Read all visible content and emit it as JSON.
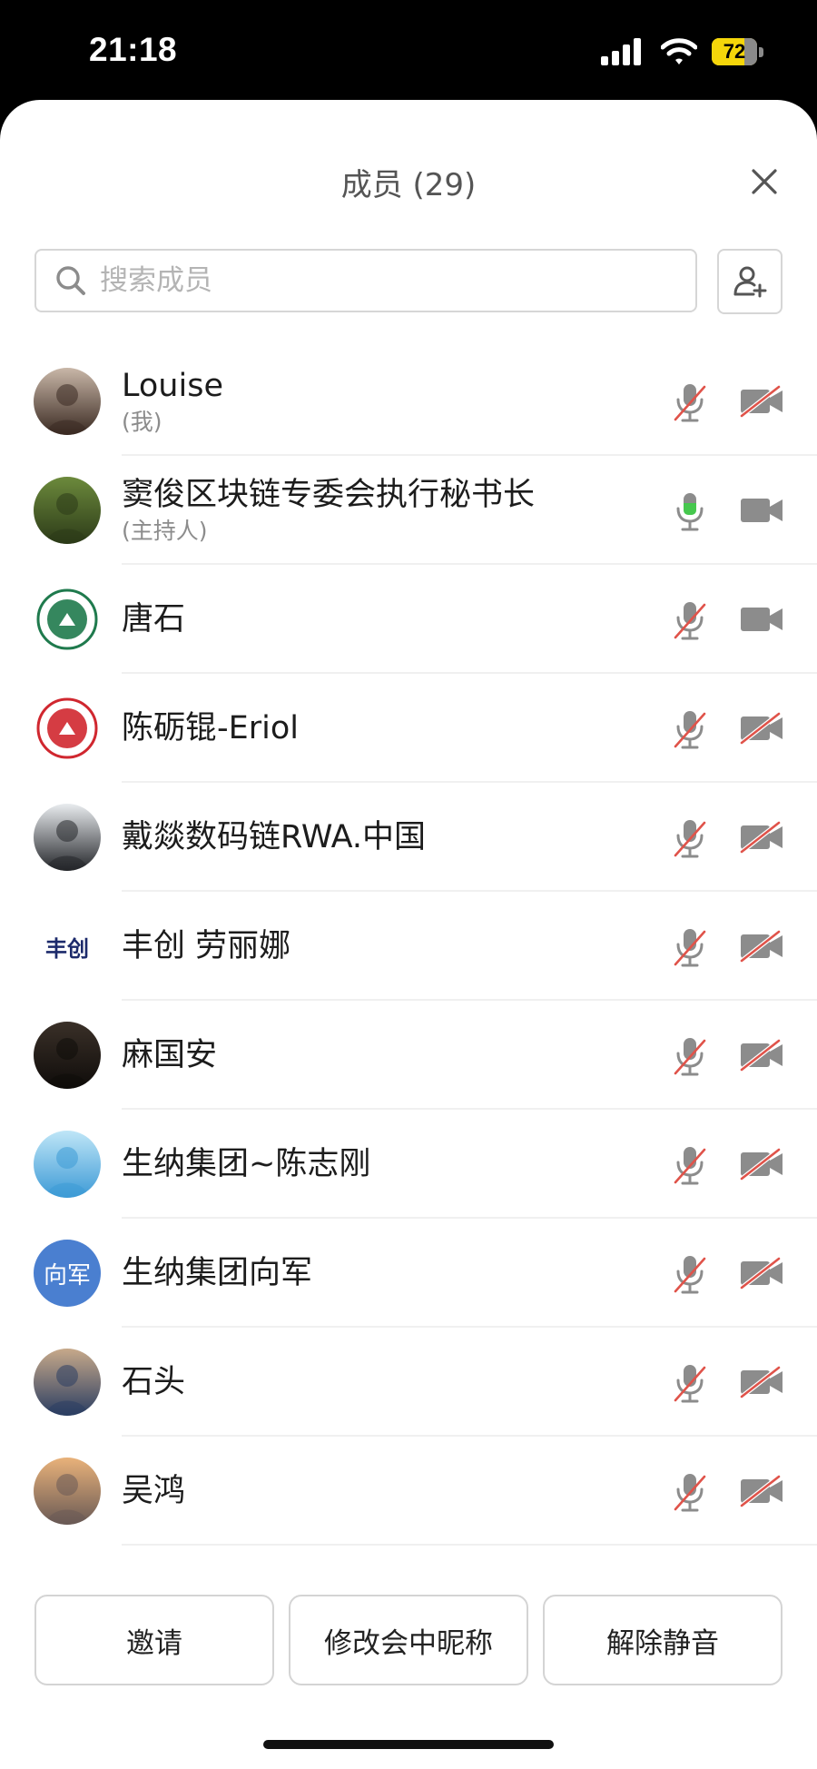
{
  "status_bar": {
    "time": "21:18",
    "battery": "72",
    "battery_level": 0.72
  },
  "sheet": {
    "title": "成员 (29)",
    "search_placeholder": "搜索成员"
  },
  "members": [
    {
      "name": "Louise",
      "role": "(我)",
      "avatar": {
        "type": "photo",
        "colors": [
          "#c9b7a8",
          "#3a2a22"
        ]
      },
      "mic": "muted",
      "cam": "off"
    },
    {
      "name": "窦俊区块链专委会执行秘书长",
      "role": "(主持人)",
      "avatar": {
        "type": "photo",
        "colors": [
          "#6c8a3c",
          "#2c3a18"
        ]
      },
      "mic": "active",
      "cam": "on"
    },
    {
      "name": "唐石",
      "role": "",
      "avatar": {
        "type": "logo",
        "colors": [
          "#ffffff",
          "#1f7a4d"
        ]
      },
      "mic": "muted",
      "cam": "on"
    },
    {
      "name": "陈砺锟-Eriol",
      "role": "",
      "avatar": {
        "type": "logo",
        "colors": [
          "#ffffff",
          "#d0272f"
        ]
      },
      "mic": "muted",
      "cam": "off"
    },
    {
      "name": "戴燚数码链RWA.中国",
      "role": "",
      "avatar": {
        "type": "photo",
        "colors": [
          "#e9ecef",
          "#24262a"
        ]
      },
      "mic": "muted",
      "cam": "off"
    },
    {
      "name": "丰创 劳丽娜",
      "role": "",
      "avatar": {
        "type": "text-logo",
        "colors": [
          "#ffffff",
          "#1c2a6b"
        ],
        "text": "丰创"
      },
      "mic": "muted",
      "cam": "off"
    },
    {
      "name": "麻国安",
      "role": "",
      "avatar": {
        "type": "photo",
        "colors": [
          "#3a3028",
          "#0f0c0a"
        ]
      },
      "mic": "muted",
      "cam": "off"
    },
    {
      "name": "生纳集团~陈志刚",
      "role": "",
      "avatar": {
        "type": "photo",
        "colors": [
          "#bfe6f7",
          "#3d9ad6"
        ]
      },
      "mic": "muted",
      "cam": "off"
    },
    {
      "name": "生纳集团向军",
      "role": "",
      "avatar": {
        "type": "initials",
        "colors": [
          "#4a7fd0",
          "#4a7fd0"
        ],
        "text": "向军"
      },
      "mic": "muted",
      "cam": "off"
    },
    {
      "name": "石头",
      "role": "",
      "avatar": {
        "type": "photo",
        "colors": [
          "#c7a98a",
          "#2b3e62"
        ]
      },
      "mic": "muted",
      "cam": "off"
    },
    {
      "name": "吴鸿",
      "role": "",
      "avatar": {
        "type": "photo",
        "colors": [
          "#e9b27a",
          "#6a5a55"
        ]
      },
      "mic": "muted",
      "cam": "off"
    }
  ],
  "buttons": {
    "invite": "邀请",
    "rename": "修改会中昵称",
    "unmute": "解除静音"
  },
  "colors": {
    "mic_active": "#46c84e",
    "slash": "#e0534a",
    "icon_gray": "#8c8c8c"
  }
}
